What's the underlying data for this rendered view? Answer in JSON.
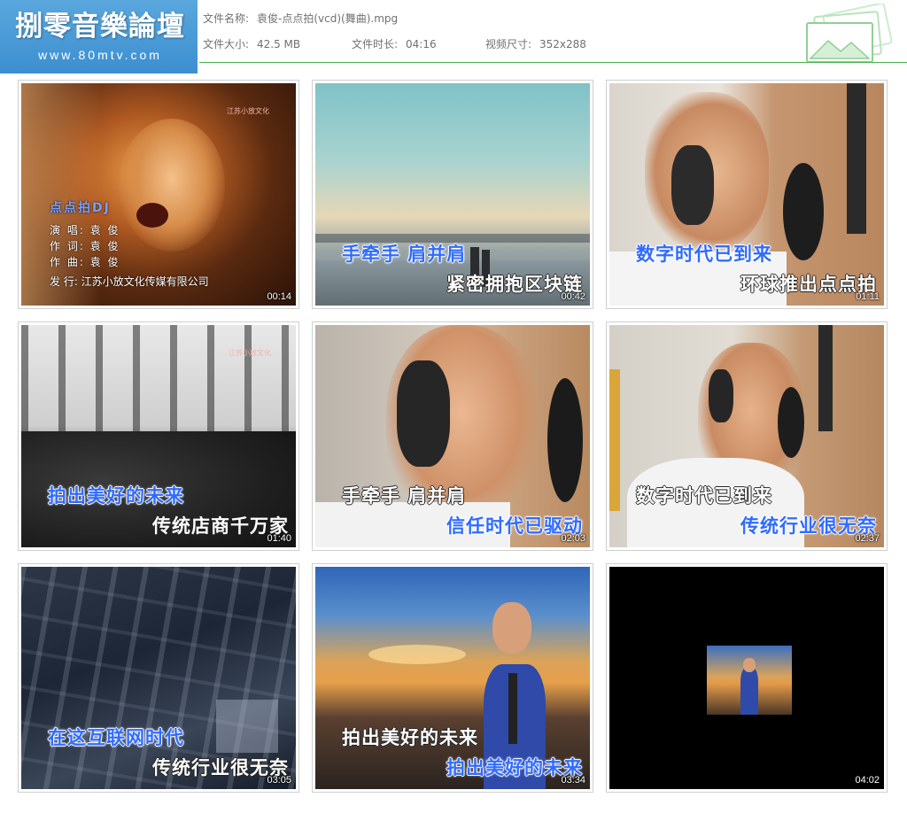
{
  "header": {
    "logo_title": "捌零音樂論壇",
    "logo_url": "www.80mtv.com",
    "file_name_label": "文件名称:",
    "file_name": "袁俊-点点拍(vcd)(舞曲).mpg",
    "file_size_label": "文件大小:",
    "file_size": "42.5 MB",
    "duration_label": "文件时长:",
    "duration": "04:16",
    "resolution_label": "视频尺寸:",
    "resolution": "352x288",
    "accent": "#49b24c",
    "logo_bg": "#3c8fd0"
  },
  "thumbnails": [
    {
      "timestamp": "00:14",
      "credit_title": "点点拍DJ",
      "credits": [
        "演  唱: 袁  俊",
        "作  词: 袁  俊",
        "作  曲: 袁  俊",
        "发  行: 江苏小放文化传媒有限公司"
      ],
      "watermark": "江苏小放文化"
    },
    {
      "timestamp": "00:42",
      "lyric_1": "手牵手 肩并肩",
      "lyric_2": "紧密拥抱区块链"
    },
    {
      "timestamp": "01:11",
      "lyric_1": "数字时代已到来",
      "lyric_2": "环球推出点点拍"
    },
    {
      "timestamp": "01:40",
      "lyric_1": "拍出美好的未来",
      "lyric_2": "传统店商千万家",
      "watermark": "江苏小放文化"
    },
    {
      "timestamp": "02:03",
      "lyric_1": "手牵手 肩并肩",
      "lyric_2": "信任时代已驱动"
    },
    {
      "timestamp": "02:37",
      "lyric_1": "数字时代已到来",
      "lyric_2": "传统行业很无奈"
    },
    {
      "timestamp": "03:05",
      "lyric_1": "在这互联网时代",
      "lyric_2": "传统行业很无奈"
    },
    {
      "timestamp": "03:34",
      "lyric_1": "拍出美好的未来",
      "lyric_2": "拍出美好的未来"
    },
    {
      "timestamp": "04:02"
    }
  ]
}
